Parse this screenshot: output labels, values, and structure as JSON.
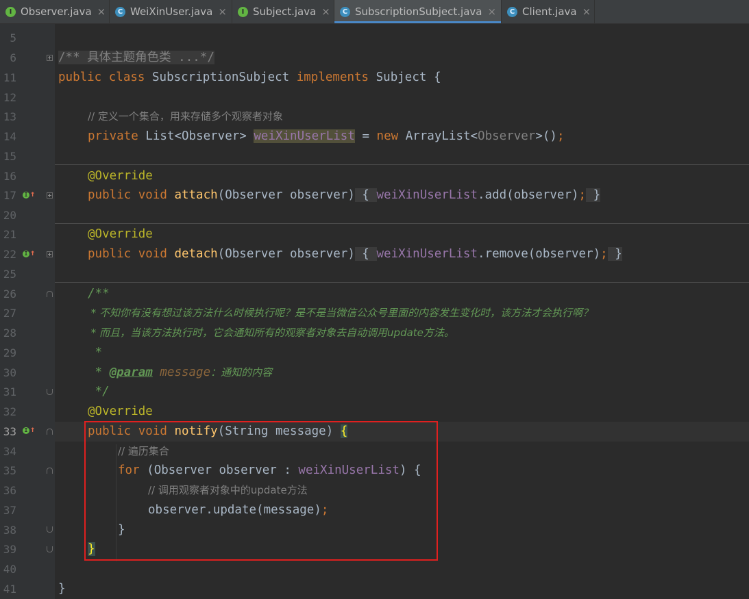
{
  "tabs": [
    {
      "label": "Observer.java",
      "icon": "interface-icon",
      "glyph": "I"
    },
    {
      "label": "WeiXinUser.java",
      "icon": "class-icon",
      "glyph": "C"
    },
    {
      "label": "Subject.java",
      "icon": "interface-icon",
      "glyph": "I"
    },
    {
      "label": "SubscriptionSubject.java",
      "icon": "class-icon",
      "glyph": "C"
    },
    {
      "label": "Client.java",
      "icon": "class-icon",
      "glyph": "C"
    }
  ],
  "active_tab": "SubscriptionSubject.java",
  "close_glyph": "×",
  "line_numbers": [
    "5",
    "6",
    "11",
    "12",
    "13",
    "14",
    "15",
    "16",
    "17",
    "20",
    "21",
    "22",
    "25",
    "26",
    "27",
    "28",
    "29",
    "30",
    "31",
    "32",
    "33",
    "34",
    "35",
    "36",
    "37",
    "38",
    "39",
    "40",
    "41"
  ],
  "code": {
    "l6_comment": "/** 具体主题角色类 ...*/",
    "l11": {
      "kw1": "public",
      "kw2": "class",
      "name": "SubscriptionSubject",
      "kw3": "implements",
      "iface": "Subject",
      "brace": "{"
    },
    "l13_comment": "// 定义一个集合，用来存储多个观察者对象",
    "l14": {
      "kw": "private",
      "type": "List<Observer>",
      "field": "weiXinUserList",
      "eq": "=",
      "kwnew": "new",
      "ctor": "ArrayList<",
      "generic": "Observer",
      "tail": ">()",
      "semi": ";"
    },
    "annotation": "@Override",
    "l17": {
      "kw": "public void",
      "method": "attach",
      "params": "(Observer observer)",
      "open": "{",
      "field": "weiXinUserList",
      "call": ".add(observer)",
      "semi": ";",
      "close": "}"
    },
    "l22": {
      "kw": "public void",
      "method": "detach",
      "params": "(Observer observer)",
      "open": "{",
      "field": "weiXinUserList",
      "call": ".remove(observer)",
      "semi": ";",
      "close": "}"
    },
    "l26": "/**",
    "l27": " * 不知你有没有想过该方法什么时候执行呢？是不是当微信公众号里面的内容发生变化时，该方法才会执行啊？",
    "l28": " * 而且，当该方法执行时，它会通知所有的观察者对象去自动调用update方法。",
    "l29": " *",
    "l30": {
      "star": " * ",
      "tag": "@param",
      "pname": "message",
      "desc": "：通知的内容"
    },
    "l31": " */",
    "l33": {
      "kw": "public void",
      "method": "notify",
      "params": "(String message)",
      "brace": "{"
    },
    "l34_comment": "// 遍历集合",
    "l35": {
      "kw": "for",
      "open": "(Observer observer : ",
      "field": "weiXinUserList",
      "close": ") {"
    },
    "l36_comment": "// 调用观察者对象中的update方法",
    "l37": {
      "call": "observer.update(message)",
      "semi": ";"
    },
    "l38": "}",
    "l39": "}",
    "l41": "}"
  }
}
